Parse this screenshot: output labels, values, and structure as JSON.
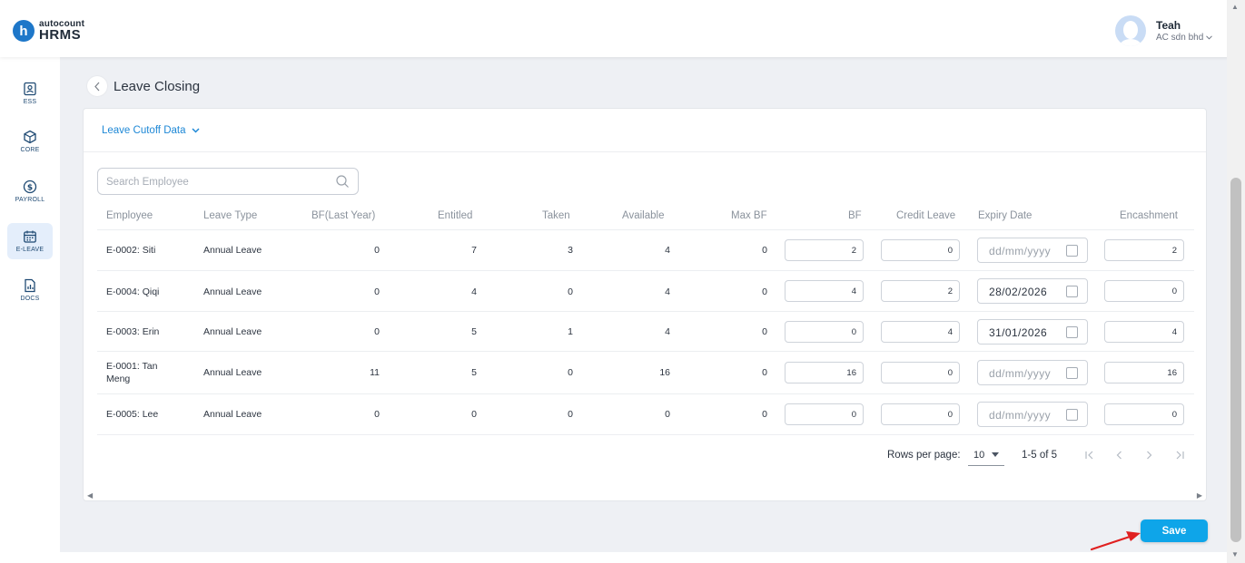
{
  "header": {
    "logo_small": "autocount",
    "logo_big": "HRMS",
    "logo_badge": "h",
    "user_name": "Teah",
    "user_company": "AC sdn bhd"
  },
  "sidebar": {
    "items": [
      {
        "label": "ESS",
        "icon": "user-card-icon",
        "active": false
      },
      {
        "label": "CORE",
        "icon": "cube-icon",
        "active": false
      },
      {
        "label": "PAYROLL",
        "icon": "dollar-icon",
        "active": false
      },
      {
        "label": "E-LEAVE",
        "icon": "calendar-icon",
        "active": true
      },
      {
        "label": "DOCS",
        "icon": "document-chart-icon",
        "active": false
      }
    ]
  },
  "page": {
    "title": "Leave Closing",
    "cutoff_label": "Leave Cutoff Data"
  },
  "search": {
    "placeholder": "Search Employee"
  },
  "table": {
    "columns": [
      "Employee",
      "Leave Type",
      "BF(Last Year)",
      "Entitled",
      "Taken",
      "Available",
      "Max BF",
      "BF",
      "Credit Leave",
      "Expiry Date",
      "Encashment"
    ],
    "date_placeholder": "dd/mm/yyyy",
    "rows": [
      {
        "employee": "E-0002: Siti",
        "leave_type": "Annual Leave",
        "bf_last_year": "0",
        "entitled": "7",
        "taken": "3",
        "available": "4",
        "max_bf": "0",
        "bf": "2",
        "credit_leave": "0",
        "expiry_date": "",
        "encashment": "2"
      },
      {
        "employee": "E-0004: Qiqi",
        "leave_type": "Annual Leave",
        "bf_last_year": "0",
        "entitled": "4",
        "taken": "0",
        "available": "4",
        "max_bf": "0",
        "bf": "4",
        "credit_leave": "2",
        "expiry_date": "28/02/2026",
        "encashment": "0"
      },
      {
        "employee": "E-0003: Erin",
        "leave_type": "Annual Leave",
        "bf_last_year": "0",
        "entitled": "5",
        "taken": "1",
        "available": "4",
        "max_bf": "0",
        "bf": "0",
        "credit_leave": "4",
        "expiry_date": "31/01/2026",
        "encashment": "4"
      },
      {
        "employee": "E-0001: Tan Meng",
        "leave_type": "Annual Leave",
        "bf_last_year": "11",
        "entitled": "5",
        "taken": "0",
        "available": "16",
        "max_bf": "0",
        "bf": "16",
        "credit_leave": "0",
        "expiry_date": "",
        "encashment": "16"
      },
      {
        "employee": "E-0005: Lee",
        "leave_type": "Annual Leave",
        "bf_last_year": "0",
        "entitled": "0",
        "taken": "0",
        "available": "0",
        "max_bf": "0",
        "bf": "0",
        "credit_leave": "0",
        "expiry_date": "",
        "encashment": "0"
      }
    ]
  },
  "pagination": {
    "rows_per_page_label": "Rows per page:",
    "rows_per_page": "10",
    "range": "1-5 of 5"
  },
  "actions": {
    "save_label": "Save"
  },
  "colors": {
    "accent": "#0ea5e9",
    "link": "#1e88d6",
    "arrow": "#e02020"
  }
}
